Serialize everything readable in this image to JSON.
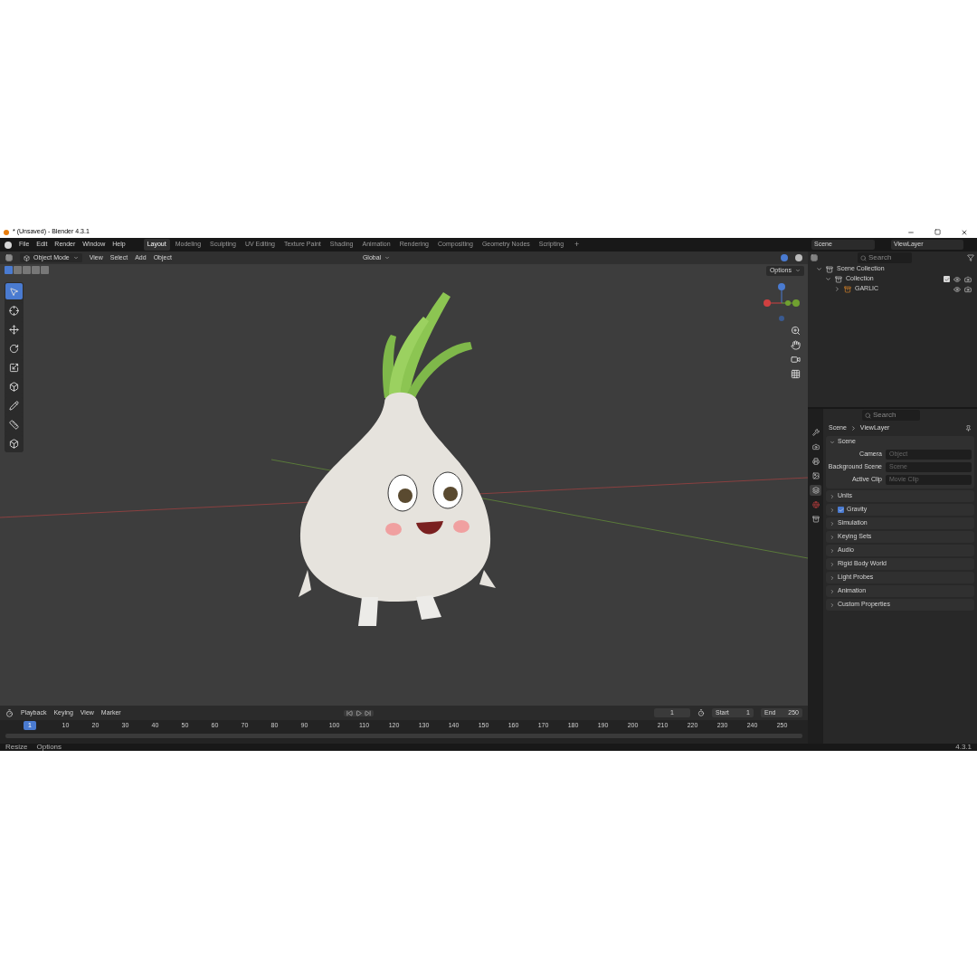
{
  "window": {
    "title": "* (Unsaved) - Blender 4.3.1"
  },
  "menu": [
    "File",
    "Edit",
    "Render",
    "Window",
    "Help"
  ],
  "workspaces": [
    {
      "label": "Layout",
      "selected": true
    },
    {
      "label": "Modeling",
      "selected": false
    },
    {
      "label": "Sculpting",
      "selected": false
    },
    {
      "label": "UV Editing",
      "selected": false
    },
    {
      "label": "Texture Paint",
      "selected": false
    },
    {
      "label": "Shading",
      "selected": false
    },
    {
      "label": "Animation",
      "selected": false
    },
    {
      "label": "Rendering",
      "selected": false
    },
    {
      "label": "Compositing",
      "selected": false
    },
    {
      "label": "Geometry Nodes",
      "selected": false
    },
    {
      "label": "Scripting",
      "selected": false
    }
  ],
  "add_workspace": "+",
  "header": {
    "mode": "Object Mode",
    "menus": [
      "View",
      "Select",
      "Add",
      "Object"
    ],
    "orientation": "Global",
    "options": "Options"
  },
  "tools": [
    {
      "selected": true
    },
    {
      "selected": false
    },
    {
      "selected": false
    },
    {
      "selected": false
    },
    {
      "selected": false
    },
    {
      "selected": false
    },
    {
      "selected": false
    },
    {
      "selected": false
    },
    {
      "selected": false
    }
  ],
  "topbar": {
    "scene": "Scene",
    "view_layer": "ViewLayer"
  },
  "outliner": {
    "search": {
      "placeholder": "Search"
    },
    "tree": [
      {
        "label": "Scene Collection",
        "expanded": true,
        "children": [
          {
            "label": "Collection",
            "expanded": true,
            "checked": true,
            "children": [
              {
                "label": "GARLIC",
                "expanded": false
              }
            ]
          }
        ]
      }
    ]
  },
  "properties": {
    "search": {
      "placeholder": "Search"
    },
    "breadcrumb": [
      "Scene",
      "ViewLayer"
    ],
    "tabs": [
      {
        "selected": false
      },
      {
        "selected": false
      },
      {
        "selected": false
      },
      {
        "selected": false
      },
      {
        "selected": true
      },
      {
        "selected": false
      },
      {
        "selected": false
      }
    ],
    "panel": {
      "title": "Scene",
      "expanded": true,
      "fields": [
        {
          "label": "Camera",
          "placeholder": "Object"
        },
        {
          "label": "Background Scene",
          "placeholder": "Scene"
        },
        {
          "label": "Active Clip",
          "placeholder": "Movie Clip"
        }
      ]
    },
    "sections": [
      {
        "kind": "plain",
        "label": "Units"
      },
      {
        "kind": "checkbox",
        "label": "Gravity",
        "checked": true
      },
      {
        "kind": "plain",
        "label": "Simulation"
      },
      {
        "kind": "plain",
        "label": "Keying Sets"
      },
      {
        "kind": "plain",
        "label": "Audio"
      },
      {
        "kind": "plain",
        "label": "Rigid Body World"
      },
      {
        "kind": "plain",
        "label": "Light Probes"
      },
      {
        "kind": "plain",
        "label": "Animation"
      },
      {
        "kind": "plain",
        "label": "Custom Properties"
      }
    ]
  },
  "timeline": {
    "menus": [
      "Playback",
      "Keying",
      "View",
      "Marker"
    ],
    "current_frame": "1",
    "start_label": "Start",
    "start": "1",
    "end_label": "End",
    "end": "250",
    "ruler": [
      {
        "label": "1",
        "selected": true
      },
      {
        "label": "10",
        "selected": false
      },
      {
        "label": "20",
        "selected": false
      },
      {
        "label": "30",
        "selected": false
      },
      {
        "label": "40",
        "selected": false
      },
      {
        "label": "50",
        "selected": false
      },
      {
        "label": "60",
        "selected": false
      },
      {
        "label": "70",
        "selected": false
      },
      {
        "label": "80",
        "selected": false
      },
      {
        "label": "90",
        "selected": false
      },
      {
        "label": "100",
        "selected": false
      },
      {
        "label": "110",
        "selected": false
      },
      {
        "label": "120",
        "selected": false
      },
      {
        "label": "130",
        "selected": false
      },
      {
        "label": "140",
        "selected": false
      },
      {
        "label": "150",
        "selected": false
      },
      {
        "label": "160",
        "selected": false
      },
      {
        "label": "170",
        "selected": false
      },
      {
        "label": "180",
        "selected": false
      },
      {
        "label": "190",
        "selected": false
      },
      {
        "label": "200",
        "selected": false
      },
      {
        "label": "210",
        "selected": false
      },
      {
        "label": "220",
        "selected": false
      },
      {
        "label": "230",
        "selected": false
      },
      {
        "label": "240",
        "selected": false
      },
      {
        "label": "250",
        "selected": false
      }
    ]
  },
  "status_bar": {
    "items": [
      "Resize",
      "Options"
    ],
    "version": "4.3.1"
  }
}
